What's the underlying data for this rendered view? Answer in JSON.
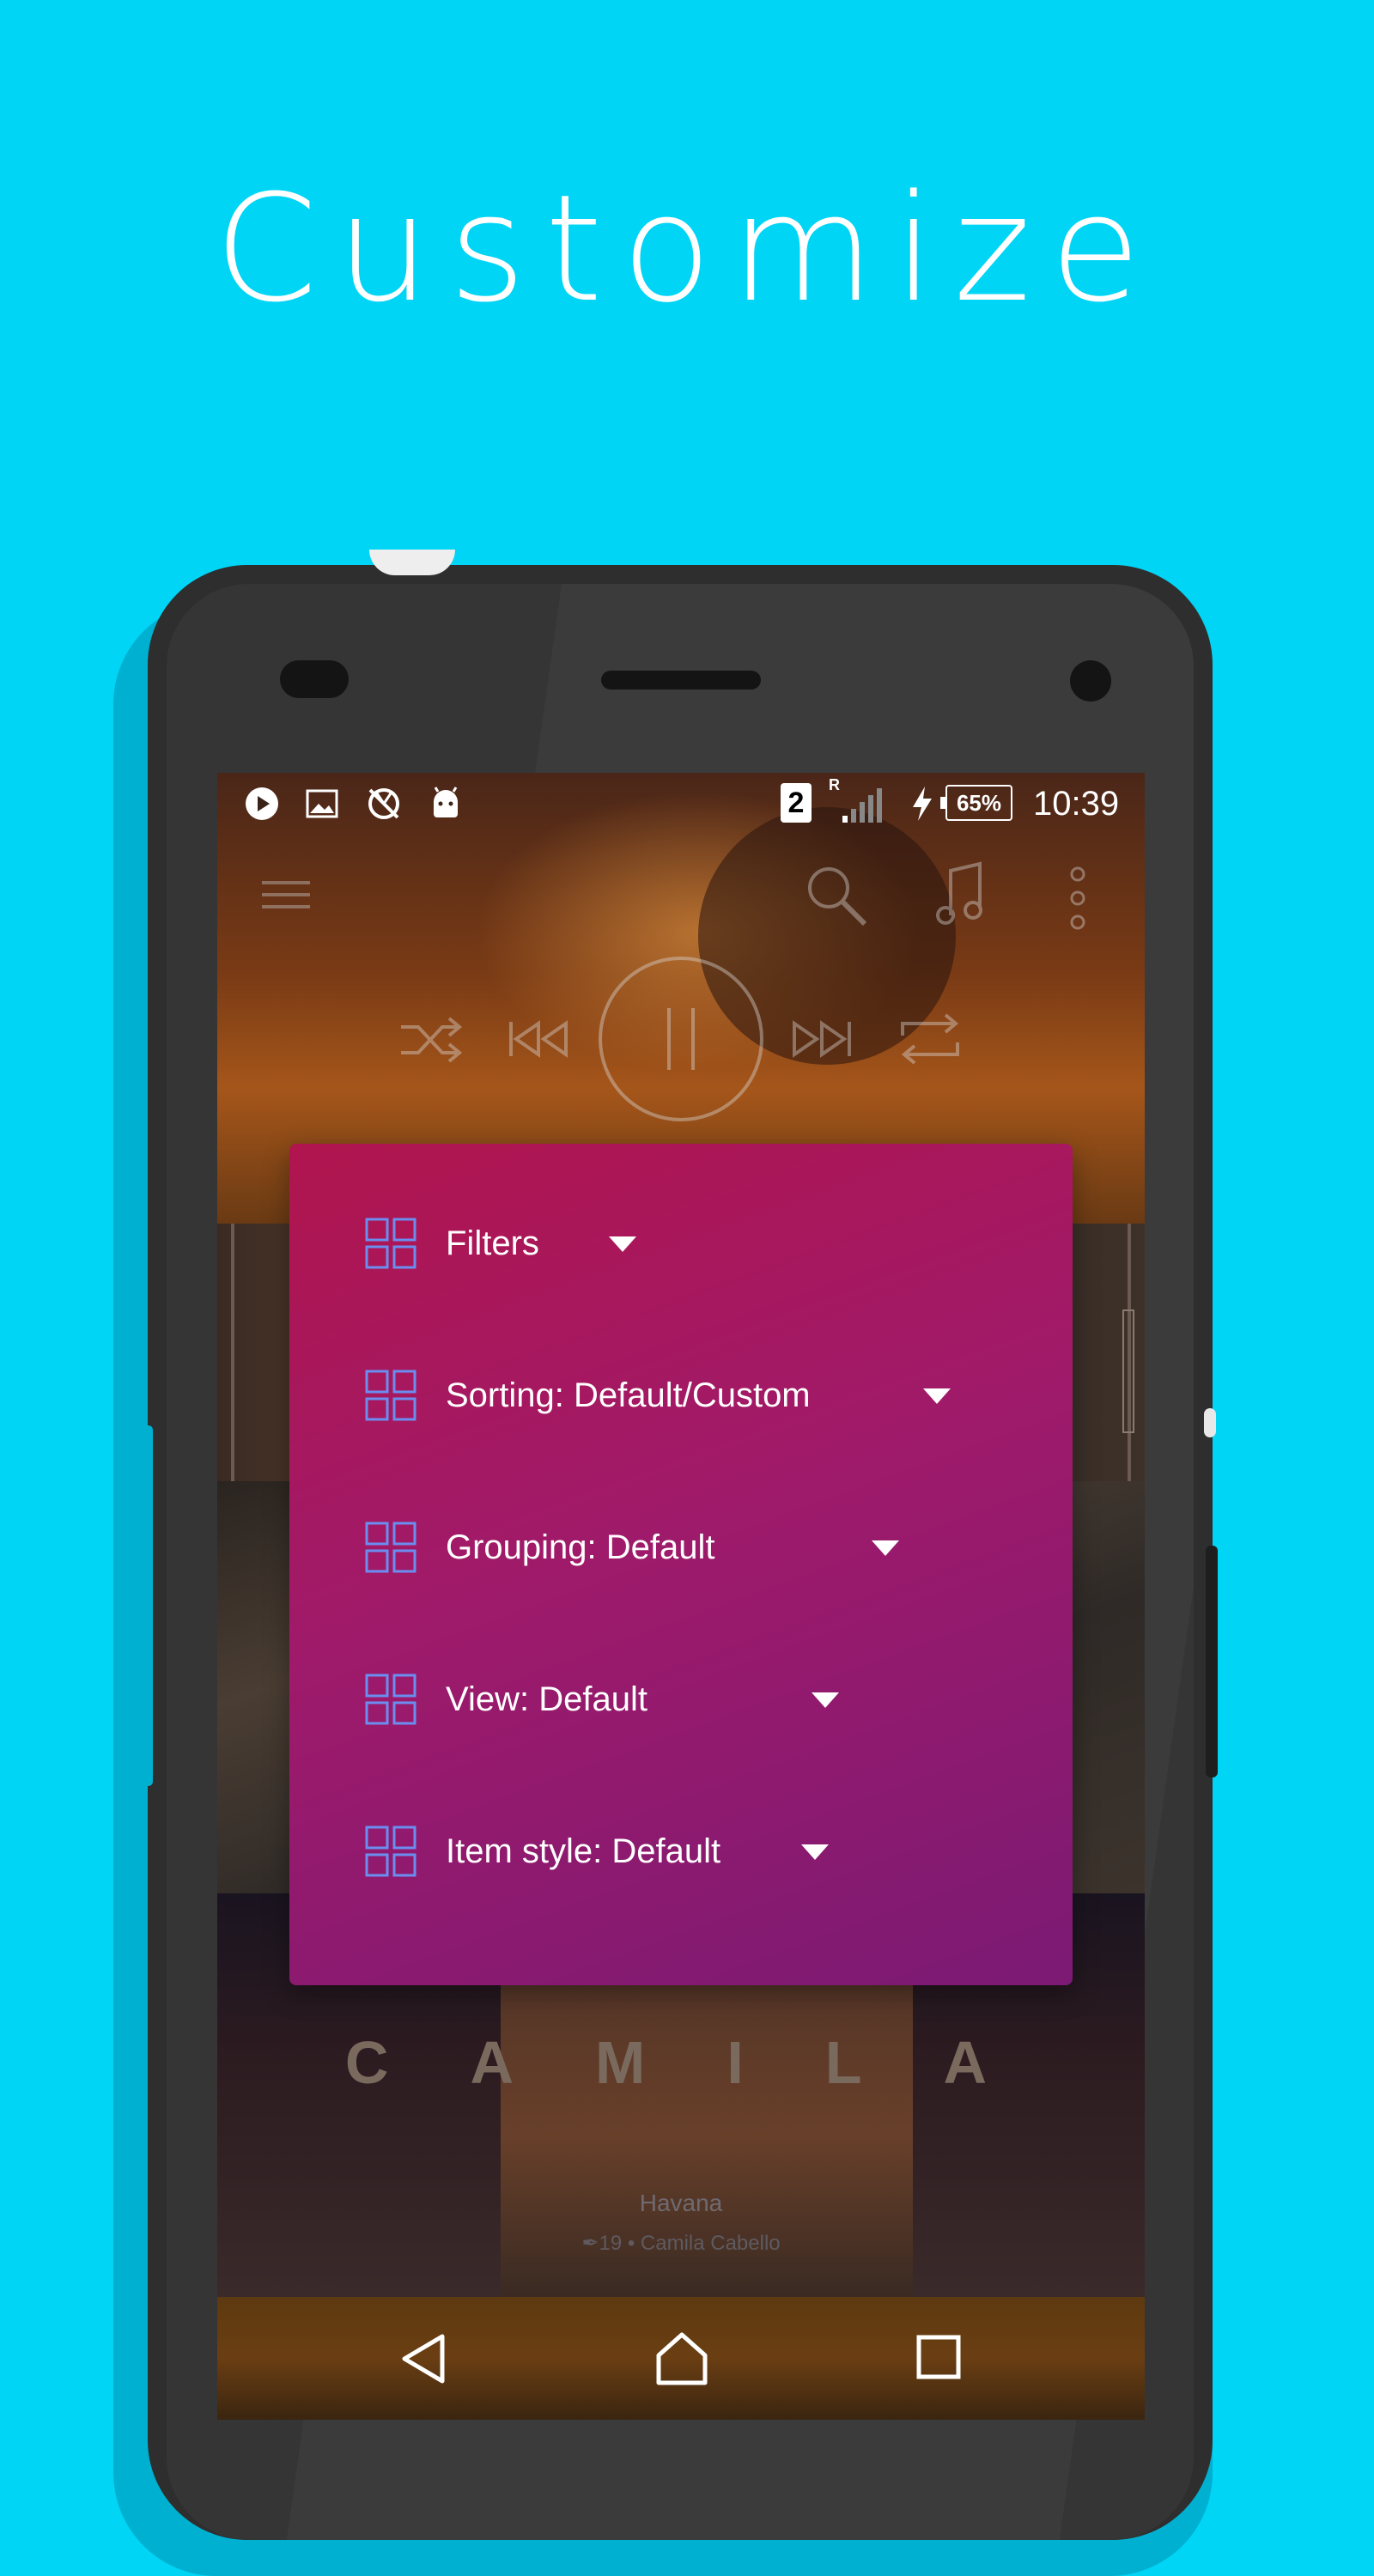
{
  "headline": "Customize",
  "status_bar": {
    "icons": [
      "play-circle-icon",
      "image-icon",
      "sync-off-icon",
      "android-icon"
    ],
    "sim_slot": "2",
    "roaming": "R",
    "battery": "65%",
    "time": "10:39"
  },
  "toolbar": {
    "icons": [
      "menu-icon",
      "search-icon",
      "music-note-icon",
      "more-vert-icon"
    ]
  },
  "player_controls": {
    "icons": [
      "shuffle-icon",
      "previous-icon",
      "pause-icon",
      "next-icon",
      "repeat-icon"
    ]
  },
  "menu": {
    "items": [
      {
        "label": "Filters"
      },
      {
        "label": "Sorting: Default/Custom"
      },
      {
        "label": "Grouping: Default"
      },
      {
        "label": "View: Default"
      },
      {
        "label": "Item style: Default"
      }
    ]
  },
  "album": {
    "artist_art_text": "CAMILA",
    "track_title": "Havana",
    "track_subtitle": "✒19 • Camila Cabello"
  },
  "nav_bar": {
    "icons": [
      "back-icon",
      "home-icon",
      "recents-icon"
    ]
  },
  "colors": {
    "background": "#00d5f5",
    "menu_gradient_start": "#b0154e",
    "menu_gradient_end": "#7b1a74",
    "menu_icon": "#6a8ef0"
  }
}
